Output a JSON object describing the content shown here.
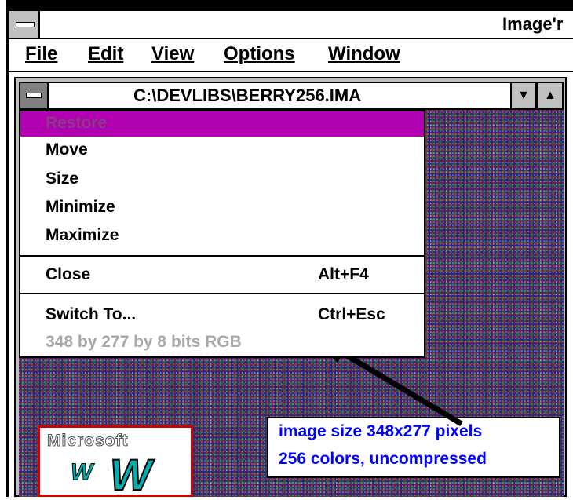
{
  "window": {
    "app_title": "Image'r",
    "menu": [
      "File",
      "Edit",
      "View",
      "Options",
      "Window"
    ]
  },
  "child_window": {
    "title": "C:\\DEVLIBS\\BERRY256.IMA"
  },
  "system_menu": {
    "items": [
      {
        "label": "Restore",
        "shortcut": "",
        "enabled": false,
        "highlighted": true
      },
      {
        "label": "Move",
        "shortcut": "",
        "enabled": true
      },
      {
        "label": "Size",
        "shortcut": "",
        "enabled": true
      },
      {
        "label": "Minimize",
        "shortcut": "",
        "enabled": true
      },
      {
        "label": "Maximize",
        "shortcut": "",
        "enabled": true
      },
      {
        "label": "Close",
        "shortcut": "Alt+F4",
        "enabled": true
      },
      {
        "label": "Switch To...",
        "shortcut": "Ctrl+Esc",
        "enabled": true
      },
      {
        "label": "348 by 277 by 8 bits RGB",
        "shortcut": "",
        "enabled": false
      }
    ]
  },
  "logo": {
    "text": "Microsoft",
    "letter": "W"
  },
  "annotation": {
    "line1": "image size 348x277 pixels",
    "line2": "256 colors, uncompressed"
  },
  "colors": {
    "highlight": "#b000b0",
    "annotation_text": "#0000ff",
    "logo_border": "#d00000"
  }
}
